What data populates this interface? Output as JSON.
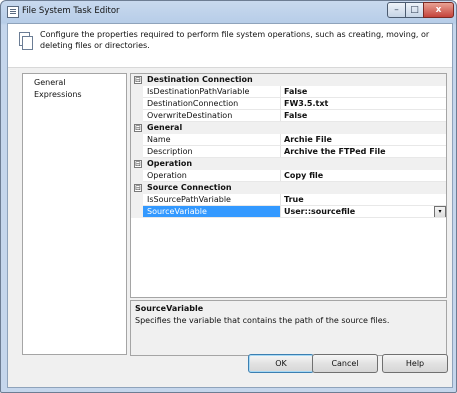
{
  "window": {
    "title": "File System Task Editor",
    "controls": {
      "minimize": "–",
      "maximize": "□",
      "close": "x"
    }
  },
  "header": {
    "description": "Configure the properties required to perform file system operations, such as creating, moving, or deleting files or directories."
  },
  "nav": {
    "items": [
      {
        "label": "General",
        "selected": true
      },
      {
        "label": "Expressions",
        "selected": false
      }
    ]
  },
  "properties": {
    "categories": [
      {
        "name": "Destination Connection",
        "expander": "⊟",
        "rows": [
          {
            "name": "IsDestinationPathVariable",
            "value": "False"
          },
          {
            "name": "DestinationConnection",
            "value": "FW3.5.txt"
          },
          {
            "name": "OverwriteDestination",
            "value": "False"
          }
        ]
      },
      {
        "name": "General",
        "expander": "⊟",
        "rows": [
          {
            "name": "Name",
            "value": "Archie File"
          },
          {
            "name": "Description",
            "value": "Archive the FTPed File"
          }
        ]
      },
      {
        "name": "Operation",
        "expander": "⊟",
        "rows": [
          {
            "name": "Operation",
            "value": "Copy file"
          }
        ]
      },
      {
        "name": "Source Connection",
        "expander": "⊟",
        "rows": [
          {
            "name": "IsSourcePathVariable",
            "value": "True"
          },
          {
            "name": "SourceVariable",
            "value": "User::sourcefile",
            "selected": true,
            "dropdown": "▾"
          }
        ]
      }
    ]
  },
  "description_panel": {
    "title": "SourceVariable",
    "text": "Specifies the variable that contains the path of the source files."
  },
  "buttons": {
    "ok": "OK",
    "cancel": "Cancel",
    "help": "Help"
  },
  "colors": {
    "selection": "#3399ff",
    "titlebar": "#b7cde8",
    "close_button": "#c4433b"
  }
}
